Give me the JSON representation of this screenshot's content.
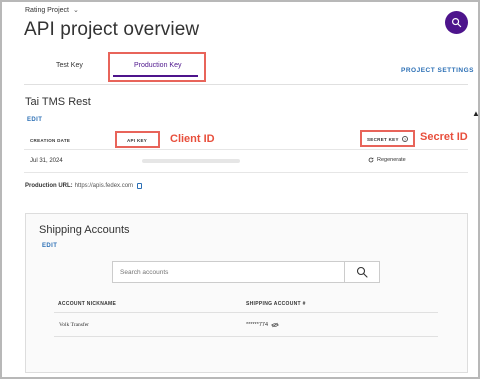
{
  "header": {
    "project_switcher": "Rating Project",
    "title": "API project overview"
  },
  "tabs": [
    {
      "label": "Test Key",
      "active": false
    },
    {
      "label": "Production Key",
      "active": true
    }
  ],
  "project_settings_label": "PROJECT SETTINGS",
  "project": {
    "name": "Tai TMS Rest",
    "edit_label": "EDIT"
  },
  "keys_table": {
    "headers": {
      "creation_date": "CREATION DATE",
      "api_key": "API KEY",
      "secret_key": "SECRET KEY"
    },
    "row": {
      "creation_date": "Jul 31, 2024",
      "regenerate_label": "Regenerate"
    }
  },
  "annotations": {
    "client_id": "Client ID",
    "secret_id": "Secret ID"
  },
  "production_url": {
    "label": "Production URL:",
    "value": "https://apis.fedex.com"
  },
  "shipping_accounts": {
    "title": "Shipping Accounts",
    "edit_label": "EDIT",
    "search_placeholder": "Search accounts",
    "headers": {
      "nickname": "ACCOUNT NICKNAME",
      "account_number": "SHIPPING ACCOUNT #"
    },
    "rows": [
      {
        "nickname": "Volk Transfer",
        "account_number": "******774"
      }
    ]
  },
  "colors": {
    "brand_purple": "#4d148c",
    "link_blue": "#2b6fb5",
    "annotation_red": "#e84f3c"
  },
  "icons": [
    "chevron-down-icon",
    "search-icon",
    "info-icon",
    "refresh-icon",
    "copy-icon",
    "eye-off-icon",
    "cursor-icon"
  ]
}
